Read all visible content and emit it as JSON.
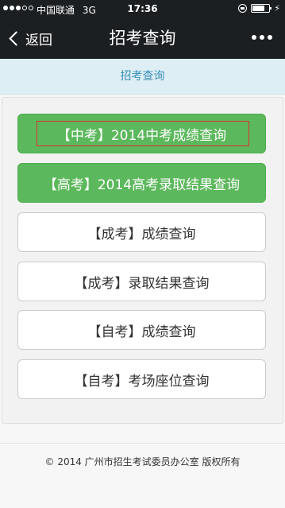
{
  "status_bar": {
    "carrier": "中国联通",
    "network": "3G",
    "time": "17:36"
  },
  "nav": {
    "back_label": "返回",
    "title": "招考查询"
  },
  "subtitle": "招考查询",
  "buttons": [
    "【中考】2014中考成绩查询",
    "【高考】2014高考录取结果查询",
    "【成考】成绩查询",
    "【成考】录取结果查询",
    "【自考】成绩查询",
    "【自考】考场座位查询"
  ],
  "footer": "© 2014 广州市招生考试委员办公室 版权所有",
  "colors": {
    "nav_background": "#1c1f22",
    "button_green": "#5cb85c",
    "subtitle_text": "#3a8fb7",
    "highlight_border": "#d9342b"
  },
  "icons": [
    "signal-dots-icon",
    "lock-rotation-icon",
    "battery-icon",
    "charging-icon",
    "back-chevron-icon",
    "more-dots-icon"
  ]
}
